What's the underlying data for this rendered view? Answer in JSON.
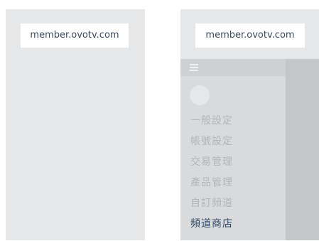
{
  "left_phone": {
    "url": "member.ovotv.com"
  },
  "right_phone": {
    "url": "member.ovotv.com",
    "menu_icon": "hamburger-icon",
    "menu": [
      {
        "label": "一般設定",
        "active": false
      },
      {
        "label": "帳號設定",
        "active": false
      },
      {
        "label": "交易管理",
        "active": false
      },
      {
        "label": "產品管理",
        "active": false
      },
      {
        "label": "自訂頻道",
        "active": false
      },
      {
        "label": "頻道商店",
        "active": true
      }
    ]
  },
  "colors": {
    "screen_bg": "#e6e7e9",
    "drawer_bg": "#d9dadc",
    "overlay": "#c5c6c8",
    "menu_inactive": "#b3b5b8",
    "menu_active": "#2f4a66"
  }
}
